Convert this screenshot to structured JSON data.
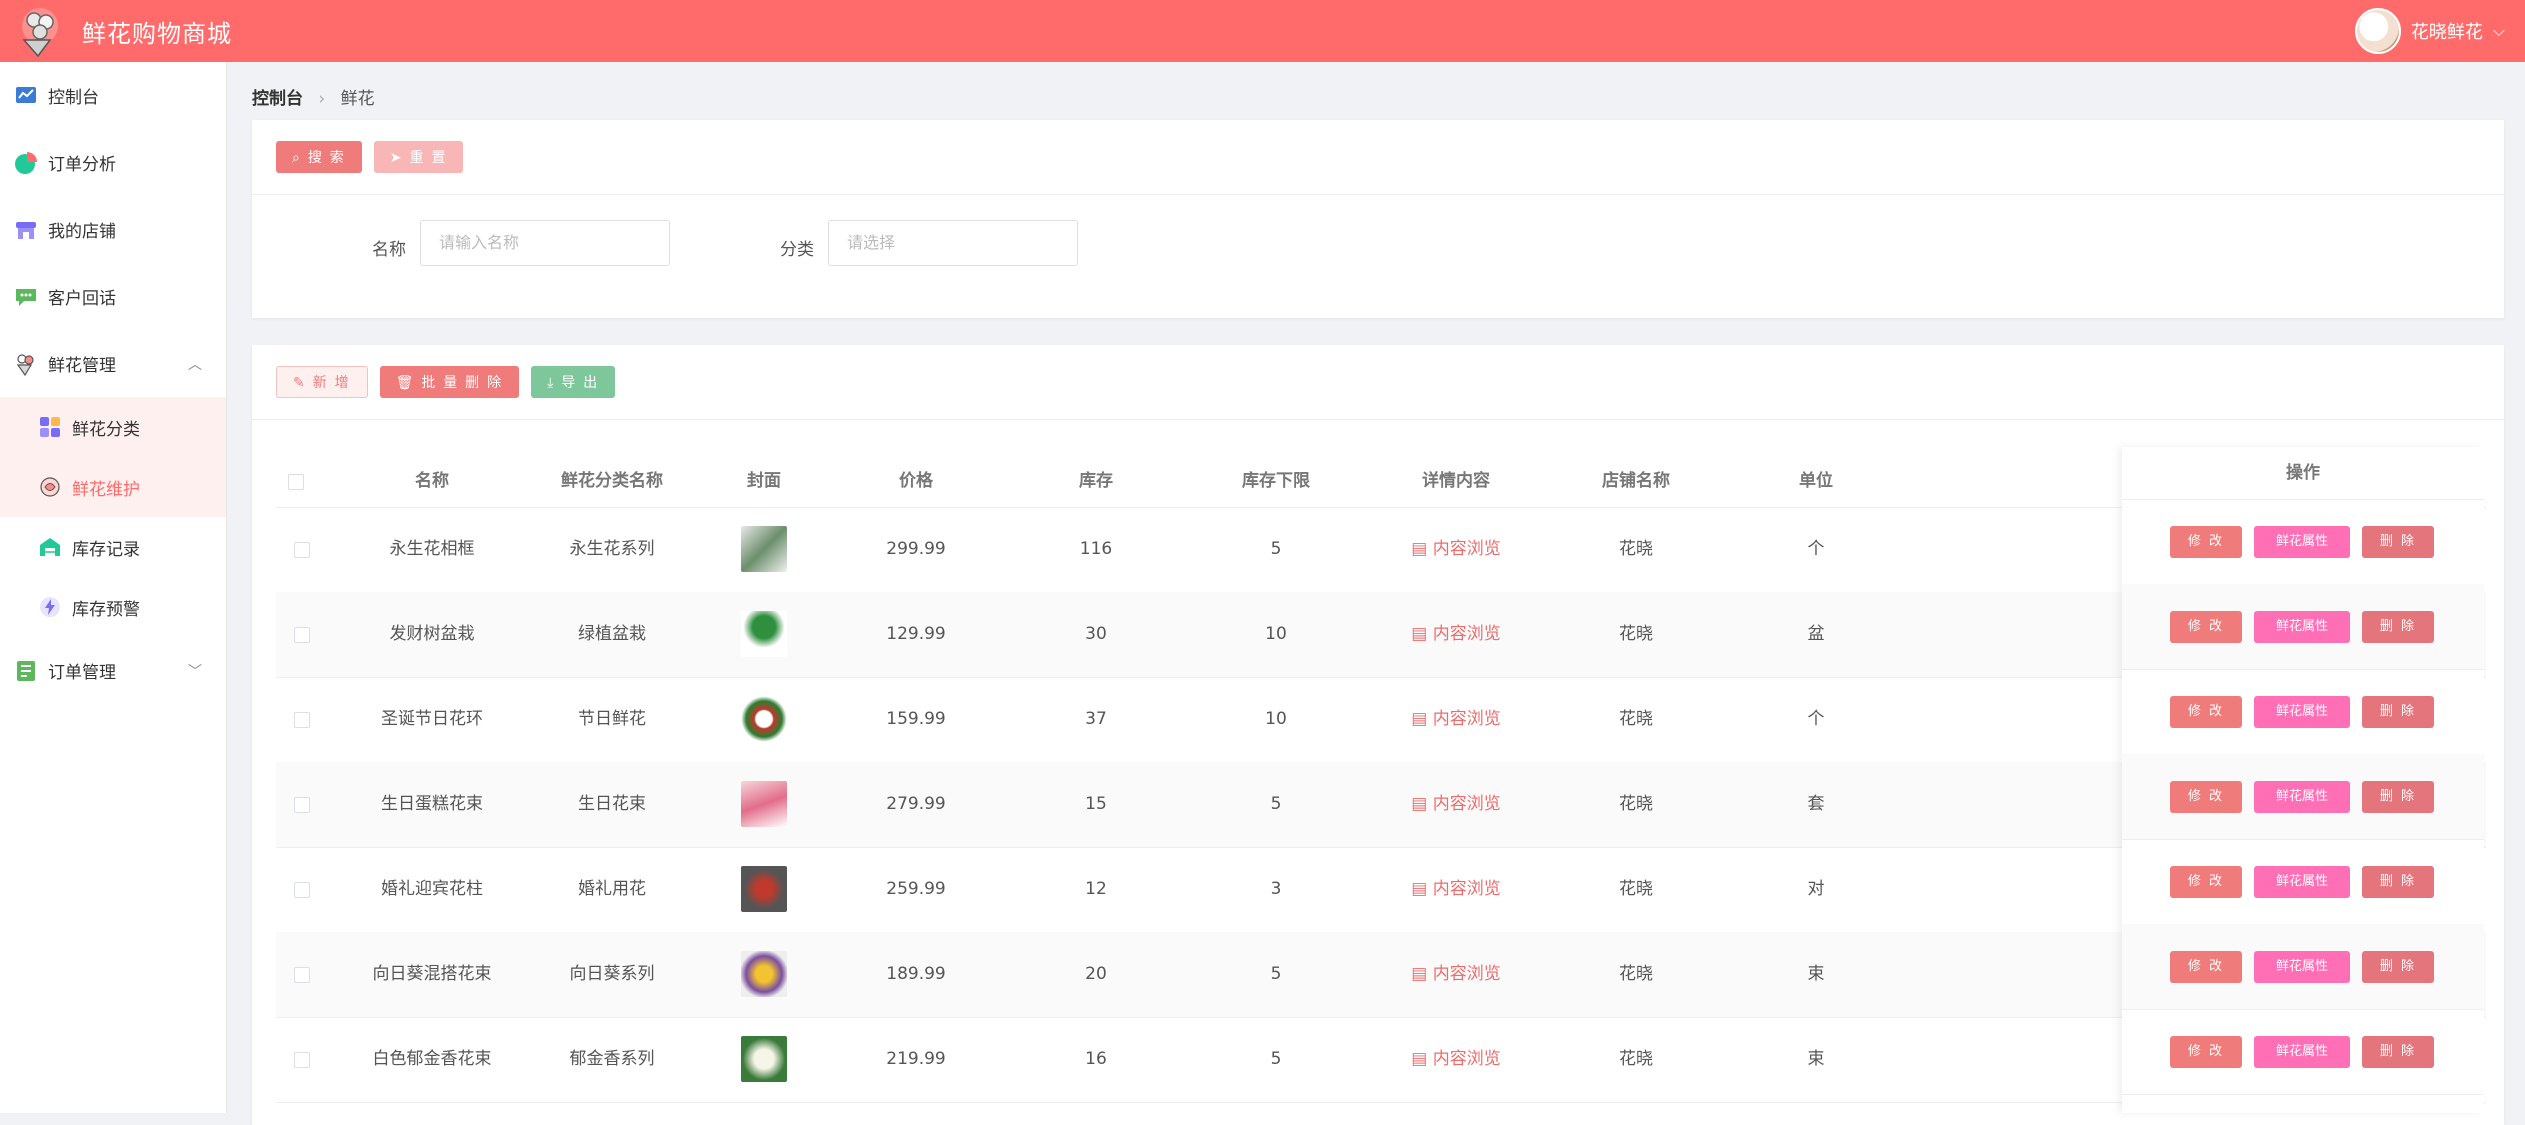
{
  "header": {
    "brand": "鲜花购物商城",
    "user": "花晓鲜花"
  },
  "sidebar": {
    "items": [
      {
        "label": "控制台"
      },
      {
        "label": "订单分析"
      },
      {
        "label": "我的店铺"
      },
      {
        "label": "客户回话"
      },
      {
        "label": "鲜花管理"
      },
      {
        "label": "鲜花分类"
      },
      {
        "label": "鲜花维护"
      },
      {
        "label": "库存记录"
      },
      {
        "label": "库存预警"
      },
      {
        "label": "订单管理"
      }
    ]
  },
  "breadcrumb": {
    "home": "控制台",
    "current": "鲜花"
  },
  "search": {
    "search_button": "搜 索",
    "reset_button": "重 置",
    "name_label": "名称",
    "name_placeholder": "请输入名称",
    "category_label": "分类",
    "category_placeholder": "请选择"
  },
  "toolbar": {
    "add": "新 增",
    "batch_delete": "批 量 删 除",
    "export": "导 出"
  },
  "table": {
    "headers": [
      "名称",
      "鲜花分类名称",
      "封面",
      "价格",
      "库存",
      "库存下限",
      "详情内容",
      "店铺名称",
      "单位",
      "操作"
    ],
    "rows": [
      {
        "name": "永生花相框",
        "category": "永生花系列",
        "price": "299.99",
        "stock": "116",
        "min": "5",
        "detail": "内容浏览",
        "shop": "花晓",
        "unit": "个"
      },
      {
        "name": "发财树盆栽",
        "category": "绿植盆栽",
        "price": "129.99",
        "stock": "30",
        "min": "10",
        "detail": "内容浏览",
        "shop": "花晓",
        "unit": "盆"
      },
      {
        "name": "圣诞节日花环",
        "category": "节日鲜花",
        "price": "159.99",
        "stock": "37",
        "min": "10",
        "detail": "内容浏览",
        "shop": "花晓",
        "unit": "个"
      },
      {
        "name": "生日蛋糕花束",
        "category": "生日花束",
        "price": "279.99",
        "stock": "15",
        "min": "5",
        "detail": "内容浏览",
        "shop": "花晓",
        "unit": "套"
      },
      {
        "name": "婚礼迎宾花柱",
        "category": "婚礼用花",
        "price": "259.99",
        "stock": "12",
        "min": "3",
        "detail": "内容浏览",
        "shop": "花晓",
        "unit": "对"
      },
      {
        "name": "向日葵混搭花束",
        "category": "向日葵系列",
        "price": "189.99",
        "stock": "20",
        "min": "5",
        "detail": "内容浏览",
        "shop": "花晓",
        "unit": "束"
      },
      {
        "name": "白色郁金香花束",
        "category": "郁金香系列",
        "price": "219.99",
        "stock": "16",
        "min": "5",
        "detail": "内容浏览",
        "shop": "花晓",
        "unit": "束"
      }
    ],
    "ops": {
      "edit": "修 改",
      "attr": "鲜花属性",
      "delete": "删 除"
    }
  },
  "colors": {
    "primary": "#ff6b6b",
    "pink": "#ff6fb5",
    "green": "#7ec79a"
  }
}
